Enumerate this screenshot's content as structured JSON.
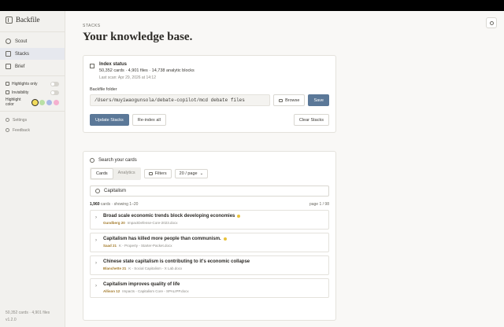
{
  "sidebar": {
    "brand": "Backfile",
    "nav": [
      {
        "label": "Scout",
        "icon": "compass-icon"
      },
      {
        "label": "Stacks",
        "icon": "stack-icon",
        "active": true
      },
      {
        "label": "Brief",
        "icon": "document-icon"
      }
    ],
    "toggles": [
      {
        "label": "Highlights only",
        "on": false
      },
      {
        "label": "Invisibility",
        "on": false
      }
    ],
    "highlight_label": "Highlight color",
    "swatches": [
      "#f2dc5d",
      "#b9e0a5",
      "#a9b9e6",
      "#f5b0cf"
    ],
    "footer_links": [
      "Settings",
      "Feedback"
    ],
    "stats": "50,352 cards · 4,901 files",
    "version": "v1.2.0"
  },
  "main": {
    "eyebrow": "STACKS",
    "title": "Your knowledge base.",
    "index": {
      "title": "Index status",
      "stats": "50,352 cards · 4,901 files · 14,738 analytic blocks",
      "last_scan": "Last scan: Apr 29, 2026 at 14:12"
    },
    "folder_label": "Backfile folder",
    "folder_path": "/Users/muyiwaogunsola/debate-copilot/mcd debate files",
    "browse_label": "Browse",
    "save_label": "Save",
    "update_label": "Update Stacks",
    "reindex_label": "Re-index all",
    "clear_label": "Clear Stacks"
  },
  "search": {
    "title": "Search your cards",
    "tabs": [
      "Cards",
      "Analytics"
    ],
    "filters_label": "Filters",
    "per_page": "20 / page",
    "query": "Capitalism",
    "count": "1,960",
    "count_suffix": "cards · showing 1–20",
    "page": "page 1 / 98",
    "results": [
      {
        "title": "Broad scale economic trends block developing economies",
        "cite": "Gundberg 20",
        "meta": "ImpactDefense-Core-2023.docx",
        "star": true
      },
      {
        "title": "Capitalism has killed more people than communism.",
        "cite": "Saad 21",
        "meta": "K - Property - Starter-Packet.docx",
        "star": true
      },
      {
        "title": "Chinese state capitalism is contributing to it's economic collapse",
        "cite": "Blanchette 21",
        "meta": "K - Social Capitalism - X Lab.docx",
        "star": false
      },
      {
        "title": "Capitalism improves quality of life",
        "cite": "Allison 12",
        "meta": "Impacts - Capitalism Core - SPALIPP.docx",
        "star": false
      }
    ]
  },
  "colors": {
    "accent": "#5b7898",
    "cite": "#a37a2a",
    "star": "#e8c23a"
  }
}
